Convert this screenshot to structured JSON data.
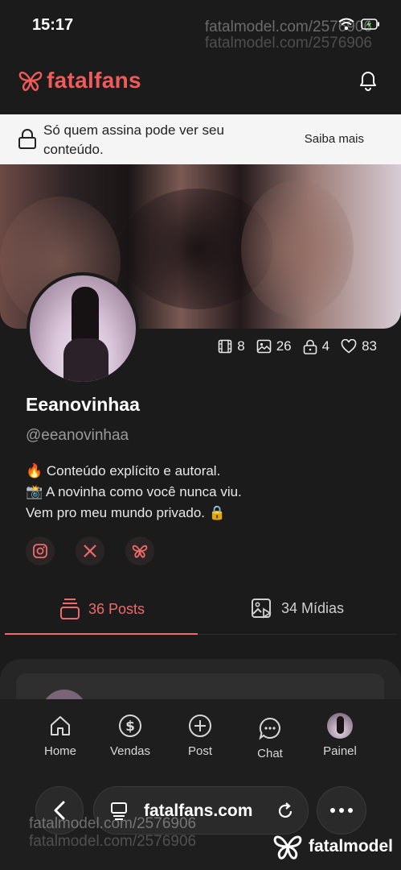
{
  "status_bar": {
    "time": "15:17",
    "battery_icon": "battery-charging-icon",
    "wifi_icon": "wifi-icon"
  },
  "watermark": {
    "line1": "fatalmodel.com/2576906",
    "line2": "fatalmodel.com/2576906",
    "brand": "fatalmodel"
  },
  "header": {
    "logo_text": "fatalfans",
    "accent_color": "#ef5a5a"
  },
  "notice": {
    "message": "Só quem assina pode ver seu conteúdo.",
    "action": "Saiba mais"
  },
  "profile": {
    "name": "Eeanovinhaa",
    "handle": "@eeanovinhaa",
    "bio": [
      "🔥 Conteúdo explícito e autoral.",
      "📸 A novinha como você nunca viu.",
      "Vem pro meu mundo privado. 🔒"
    ],
    "stats": {
      "videos": "8",
      "photos": "26",
      "locked": "4",
      "likes": "83"
    }
  },
  "tabs": {
    "posts": "36 Posts",
    "media": "34 Mídias"
  },
  "bottom_nav": {
    "home": "Home",
    "sales": "Vendas",
    "post": "Post",
    "chat": "Chat",
    "panel": "Painel"
  },
  "browser": {
    "url": "fatalfans.com"
  }
}
